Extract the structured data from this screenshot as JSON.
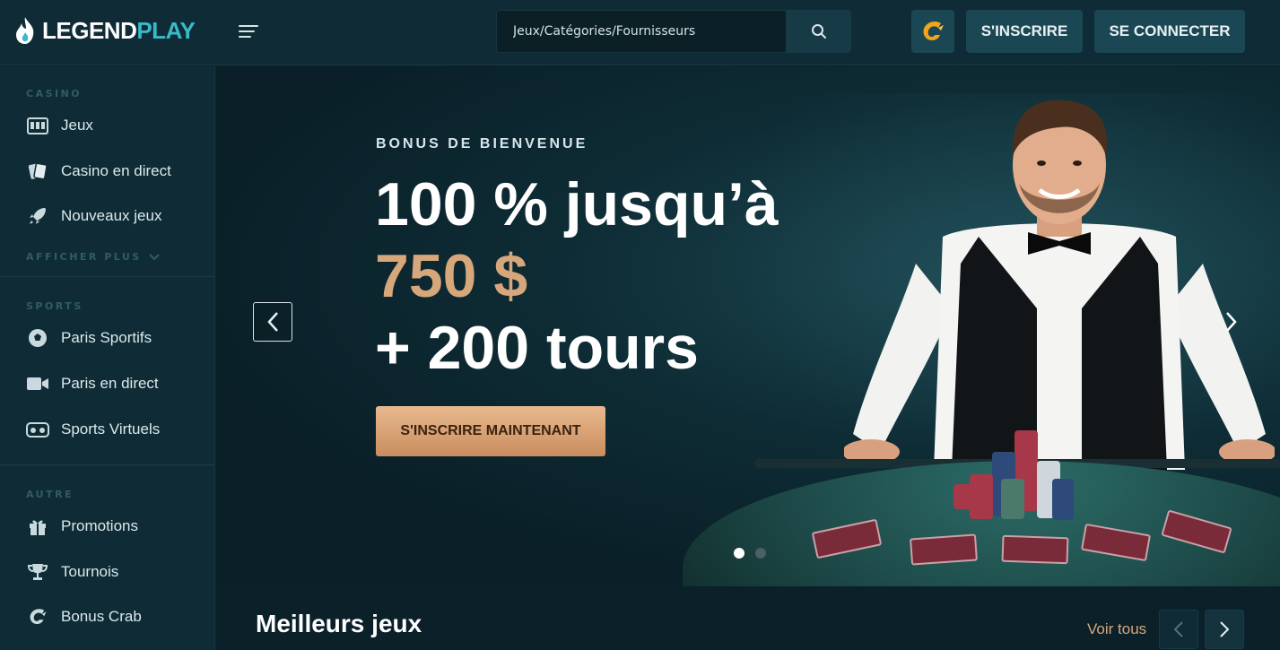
{
  "brand": {
    "part1": "LEGEND",
    "part2": "PLAY"
  },
  "search": {
    "placeholder": "Jeux/Catégories/Fournisseurs"
  },
  "header": {
    "signup_label": "S'INSCRIRE",
    "login_label": "SE CONNECTER"
  },
  "sidebar": {
    "casino_label": "CASINO",
    "casino_items": [
      {
        "label": "Jeux",
        "icon": "slot-machine-icon"
      },
      {
        "label": "Casino en direct",
        "icon": "playing-cards-icon"
      },
      {
        "label": "Nouveaux jeux",
        "icon": "rocket-icon"
      }
    ],
    "show_more_label": "AFFICHER PLUS",
    "sports_label": "SPORTS",
    "sports_items": [
      {
        "label": "Paris Sportifs",
        "icon": "soccer-ball-icon"
      },
      {
        "label": "Paris en direct",
        "icon": "video-camera-icon"
      },
      {
        "label": "Sports Virtuels",
        "icon": "vr-headset-icon"
      }
    ],
    "other_label": "AUTRE",
    "other_items": [
      {
        "label": "Promotions",
        "icon": "gift-icon"
      },
      {
        "label": "Tournois",
        "icon": "trophy-icon"
      },
      {
        "label": "Bonus Crab",
        "icon": "crab-claw-icon"
      }
    ]
  },
  "hero": {
    "subtitle": "BONUS DE BIENVENUE",
    "line1": "100 % jusqu’à",
    "line2": "750 $",
    "line3": "+ 200 tours",
    "cta_label": "S'INSCRIRE MAINTENANT",
    "slide_index": 1,
    "slide_count": 2
  },
  "section": {
    "title": "Meilleurs jeux",
    "see_all_label": "Voir tous"
  },
  "colors": {
    "accent": "#39b9c9",
    "gold": "#d6a77b",
    "background": "#0b2029",
    "panel": "#0f2c36"
  }
}
